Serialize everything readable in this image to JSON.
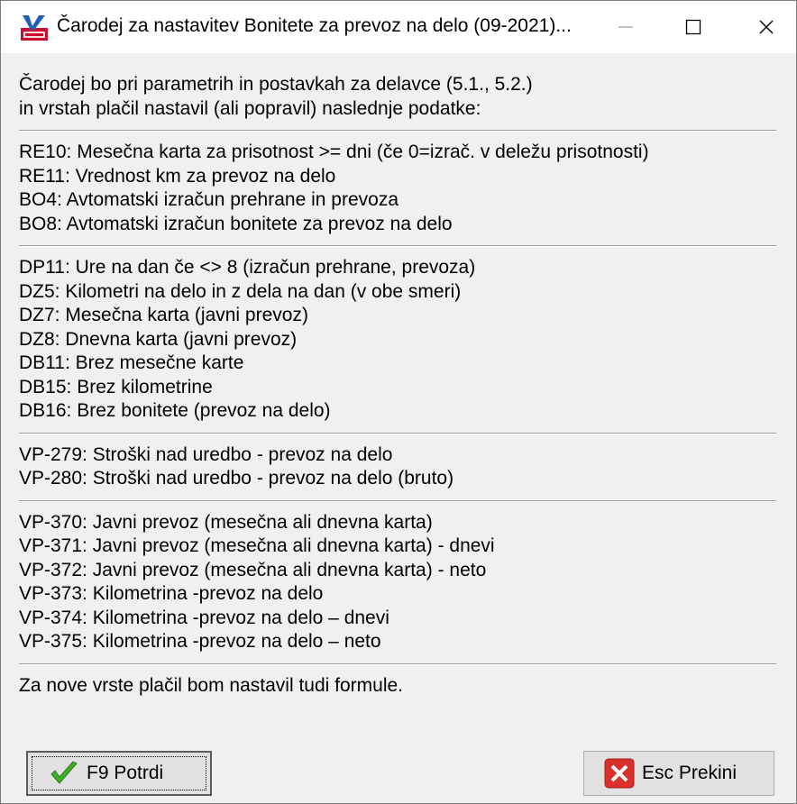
{
  "window": {
    "title": "Čarodej za nastavitev Bonitete za prevoz na delo (09-2021)...",
    "icon": "vasco-place-app-icon"
  },
  "intro": [
    "Čarodej bo pri parametrih in postavkah za delavce (5.1., 5.2.)",
    "in vrstah plačil nastavil (ali popravil) naslednje podatke:"
  ],
  "groups": [
    [
      "RE10: Mesečna karta za prisotnost >= dni (če 0=izrač. v deležu prisotnosti)",
      "RE11: Vrednost km za prevoz na delo",
      "BO4: Avtomatski izračun prehrane in prevoza",
      "BO8: Avtomatski izračun bonitete za prevoz na delo"
    ],
    [
      "DP11: Ure na dan če <> 8 (izračun prehrane, prevoza)",
      "DZ5: Kilometri na delo in z dela na dan (v obe smeri)",
      "DZ7: Mesečna karta (javni prevoz)",
      "DZ8: Dnevna karta (javni prevoz)",
      "DB11: Brez mesečne karte",
      "DB15: Brez kilometrine",
      "DB16: Brez bonitete (prevoz na delo)"
    ],
    [
      "VP-279: Stroški nad uredbo - prevoz na delo",
      "VP-280: Stroški nad uredbo - prevoz na delo (bruto)"
    ],
    [
      "VP-370: Javni prevoz (mesečna ali dnevna karta)",
      "VP-371: Javni prevoz (mesečna ali dnevna karta) - dnevi",
      "VP-372: Javni prevoz (mesečna ali dnevna karta) - neto",
      "VP-373: Kilometrina -prevoz na delo",
      "VP-374: Kilometrina -prevoz na delo – dnevi",
      "VP-375: Kilometrina -prevoz na delo – neto"
    ]
  ],
  "footer_note": "Za nove vrste plačil bom nastavil tudi formule.",
  "buttons": {
    "ok_label": "F9 Potrdi",
    "ok_icon": "checkmark-icon",
    "cancel_label": "Esc Prekini",
    "cancel_icon": "red-x-icon"
  },
  "colors": {
    "ok_icon": "#3fae2a",
    "cancel_icon": "#d9302b"
  }
}
